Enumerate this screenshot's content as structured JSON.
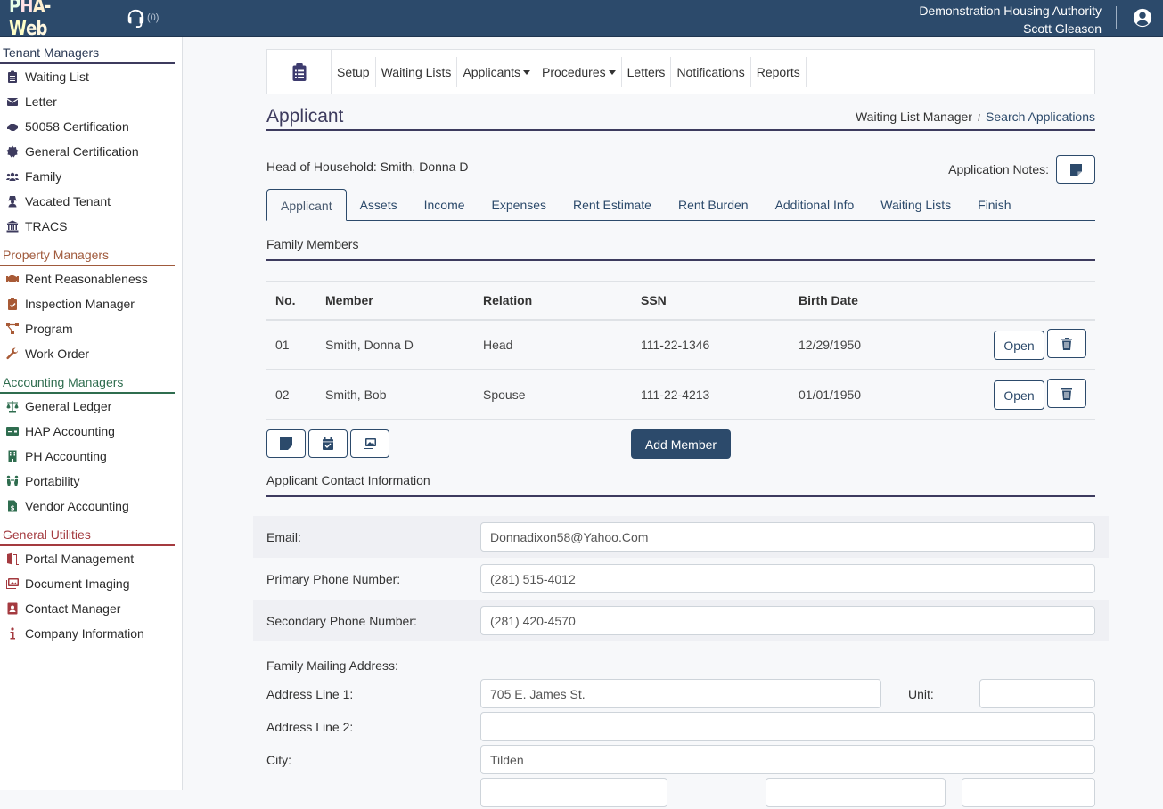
{
  "topbar": {
    "logo": "PHA-Web",
    "support_count": "(0)",
    "org_name": "Demonstration Housing Authority",
    "user_name": "Scott Gleason"
  },
  "sidebar": {
    "sections": [
      {
        "title": "Tenant Managers",
        "items": [
          {
            "label": "Waiting List",
            "icon": "clipboard-list-icon"
          },
          {
            "label": "Letter",
            "icon": "envelope-icon"
          },
          {
            "label": "50058 Certification",
            "icon": "handshake-icon"
          },
          {
            "label": "General Certification",
            "icon": "certificate-icon"
          },
          {
            "label": "Family",
            "icon": "users-icon"
          },
          {
            "label": "Vacated Tenant",
            "icon": "user-secret-icon"
          },
          {
            "label": "TRACS",
            "icon": "landmark-icon"
          }
        ]
      },
      {
        "title": "Property Managers",
        "items": [
          {
            "label": "Rent Reasonableness",
            "icon": "handshake-icon"
          },
          {
            "label": "Inspection Manager",
            "icon": "clipboard-check-icon"
          },
          {
            "label": "Program",
            "icon": "project-diagram-icon"
          },
          {
            "label": "Work Order",
            "icon": "wrench-icon"
          }
        ]
      },
      {
        "title": "Accounting Managers",
        "items": [
          {
            "label": "General Ledger",
            "icon": "balance-scale-icon"
          },
          {
            "label": "HAP Accounting",
            "icon": "money-check-icon"
          },
          {
            "label": "PH Accounting",
            "icon": "building-icon"
          },
          {
            "label": "Portability",
            "icon": "people-arrows-icon"
          },
          {
            "label": "Vendor Accounting",
            "icon": "file-invoice-dollar-icon"
          }
        ]
      },
      {
        "title": "General Utilities",
        "items": [
          {
            "label": "Portal Management",
            "icon": "door-open-icon"
          },
          {
            "label": "Document Imaging",
            "icon": "images-icon"
          },
          {
            "label": "Contact Manager",
            "icon": "address-book-icon"
          },
          {
            "label": "Company Information",
            "icon": "info-icon"
          }
        ]
      }
    ]
  },
  "subnav": {
    "items": [
      {
        "label": "Setup",
        "dropdown": false
      },
      {
        "label": "Waiting Lists",
        "dropdown": false
      },
      {
        "label": "Applicants",
        "dropdown": true
      },
      {
        "label": "Procedures",
        "dropdown": true
      },
      {
        "label": "Letters",
        "dropdown": false
      },
      {
        "label": "Notifications",
        "dropdown": false
      },
      {
        "label": "Reports",
        "dropdown": false
      }
    ]
  },
  "page": {
    "title": "Applicant",
    "breadcrumb": [
      "Waiting List Manager",
      "Search Applications"
    ],
    "head_of_household": "Head of Household: Smith, Donna D",
    "notes_label": "Application Notes:"
  },
  "tabs": [
    "Applicant",
    "Assets",
    "Income",
    "Expenses",
    "Rent Estimate",
    "Rent Burden",
    "Additional Info",
    "Waiting Lists",
    "Finish"
  ],
  "active_tab": "Applicant",
  "family": {
    "title": "Family Members",
    "columns": [
      "No.",
      "Member",
      "Relation",
      "SSN",
      "Birth Date"
    ],
    "rows": [
      {
        "no": "01",
        "member": "Smith, Donna D",
        "relation": "Head",
        "ssn": "111-22-1346",
        "birth": "12/29/1950"
      },
      {
        "no": "02",
        "member": "Smith, Bob",
        "relation": "Spouse",
        "ssn": "111-22-4213",
        "birth": "01/01/1950"
      }
    ],
    "open_label": "Open",
    "add_label": "Add Member"
  },
  "contact": {
    "title": "Applicant Contact Information",
    "email_label": "Email:",
    "email": "Donnadixon58@Yahoo.Com",
    "primary_label": "Primary Phone Number:",
    "primary": "(281) 515-4012",
    "secondary_label": "Secondary Phone Number:",
    "secondary": "(281) 420-4570",
    "mailing_label": "Family Mailing Address:",
    "addr1_label": "Address Line 1:",
    "addr1": "705 E. James St.",
    "unit_label": "Unit:",
    "unit": "",
    "addr2_label": "Address Line 2:",
    "addr2": "",
    "city_label": "City:",
    "city": "Tilden"
  }
}
